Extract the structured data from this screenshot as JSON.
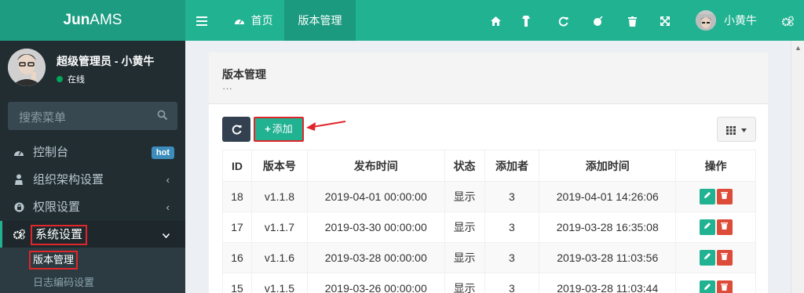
{
  "brand": {
    "bold": "Jun",
    "thin": "AMS"
  },
  "topbar": {
    "home_label": "首页",
    "active_tab": "版本管理",
    "username": "小黄牛"
  },
  "sidebar": {
    "user_name": "超级管理员 - 小黄牛",
    "status": "在线",
    "search_placeholder": "搜索菜单",
    "items": [
      {
        "label": "控制台",
        "badge": "hot"
      },
      {
        "label": "组织架构设置"
      },
      {
        "label": "权限设置"
      },
      {
        "label": "系统设置"
      }
    ],
    "subitems": [
      {
        "label": "版本管理"
      },
      {
        "label": "日志编码设置"
      }
    ]
  },
  "panel": {
    "title": "版本管理",
    "subtitle": "···",
    "add_label": "添加"
  },
  "table": {
    "headers": [
      "ID",
      "版本号",
      "发布时间",
      "状态",
      "添加者",
      "添加时间",
      "操作"
    ],
    "rows": [
      [
        "18",
        "v1.1.8",
        "2019-04-01 00:00:00",
        "显示",
        "3",
        "2019-04-01 14:26:06"
      ],
      [
        "17",
        "v1.1.7",
        "2019-03-30 00:00:00",
        "显示",
        "3",
        "2019-03-28 16:35:08"
      ],
      [
        "16",
        "v1.1.6",
        "2019-03-28 00:00:00",
        "显示",
        "3",
        "2019-03-28 11:03:56"
      ],
      [
        "15",
        "v1.1.5",
        "2019-03-26 00:00:00",
        "显示",
        "3",
        "2019-03-28 11:03:44"
      ]
    ]
  },
  "colors": {
    "topbar": "#21b292",
    "logo": "#1e9c82",
    "sidebar": "#222d32",
    "annotation": "#e0262b",
    "delete": "#dd4b39",
    "badge": "#3c8dbc"
  }
}
